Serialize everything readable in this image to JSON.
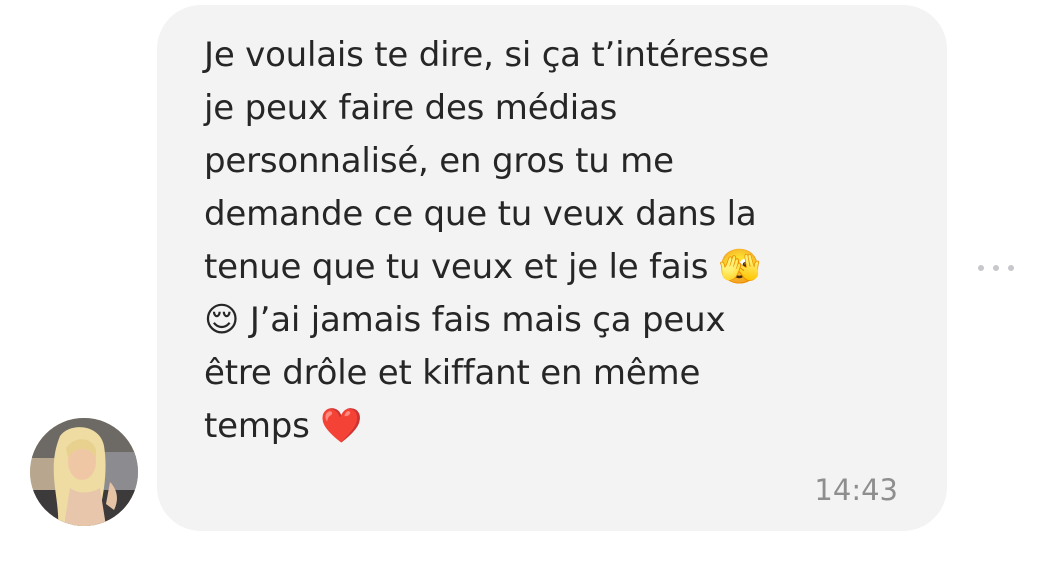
{
  "message": {
    "lines": [
      "Je voulais te dire, si ça t’intéresse",
      "je peux faire des médias",
      "personnalisé, en gros tu me",
      "demande ce que tu veux dans la",
      "tenue que tu veux et je le fais 🫣",
      "😌 J’ai jamais fais mais ça peux",
      "être drôle et kiffant en même",
      "temps ❤️"
    ],
    "timestamp": "14:43"
  },
  "colors": {
    "bubble_background": "#f3f3f3",
    "text": "#262626",
    "timestamp": "#8e8e8e",
    "more_dots": "#c7c7cc"
  },
  "icons": {
    "more": "more-horizontal-icon",
    "avatar": "sender-avatar"
  }
}
